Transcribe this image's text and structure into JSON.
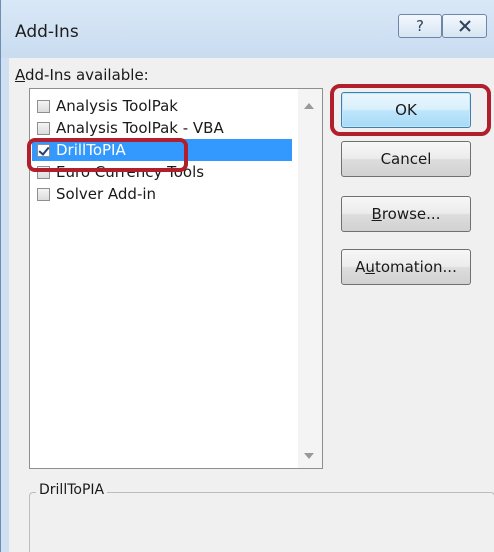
{
  "window": {
    "title": "Add-Ins",
    "help_label": "?"
  },
  "list": {
    "label_access": "A",
    "label_rest": "dd-Ins available:",
    "items": [
      {
        "label": "Analysis ToolPak",
        "checked": false
      },
      {
        "label": "Analysis ToolPak - VBA",
        "checked": false
      },
      {
        "label": "DrillToPIA",
        "checked": true
      },
      {
        "label": "Euro Currency Tools",
        "checked": false
      },
      {
        "label": "Solver Add-in",
        "checked": false
      }
    ],
    "selected_index": 2
  },
  "buttons": {
    "ok": "OK",
    "cancel": "Cancel",
    "browse_access": "B",
    "browse_rest": "rowse...",
    "automation_pre": "A",
    "automation_access": "u",
    "automation_rest": "tomation..."
  },
  "description": {
    "title": "DrillToPIA"
  },
  "colors": {
    "selection": "#3399ff",
    "highlight": "#b11f2c"
  }
}
